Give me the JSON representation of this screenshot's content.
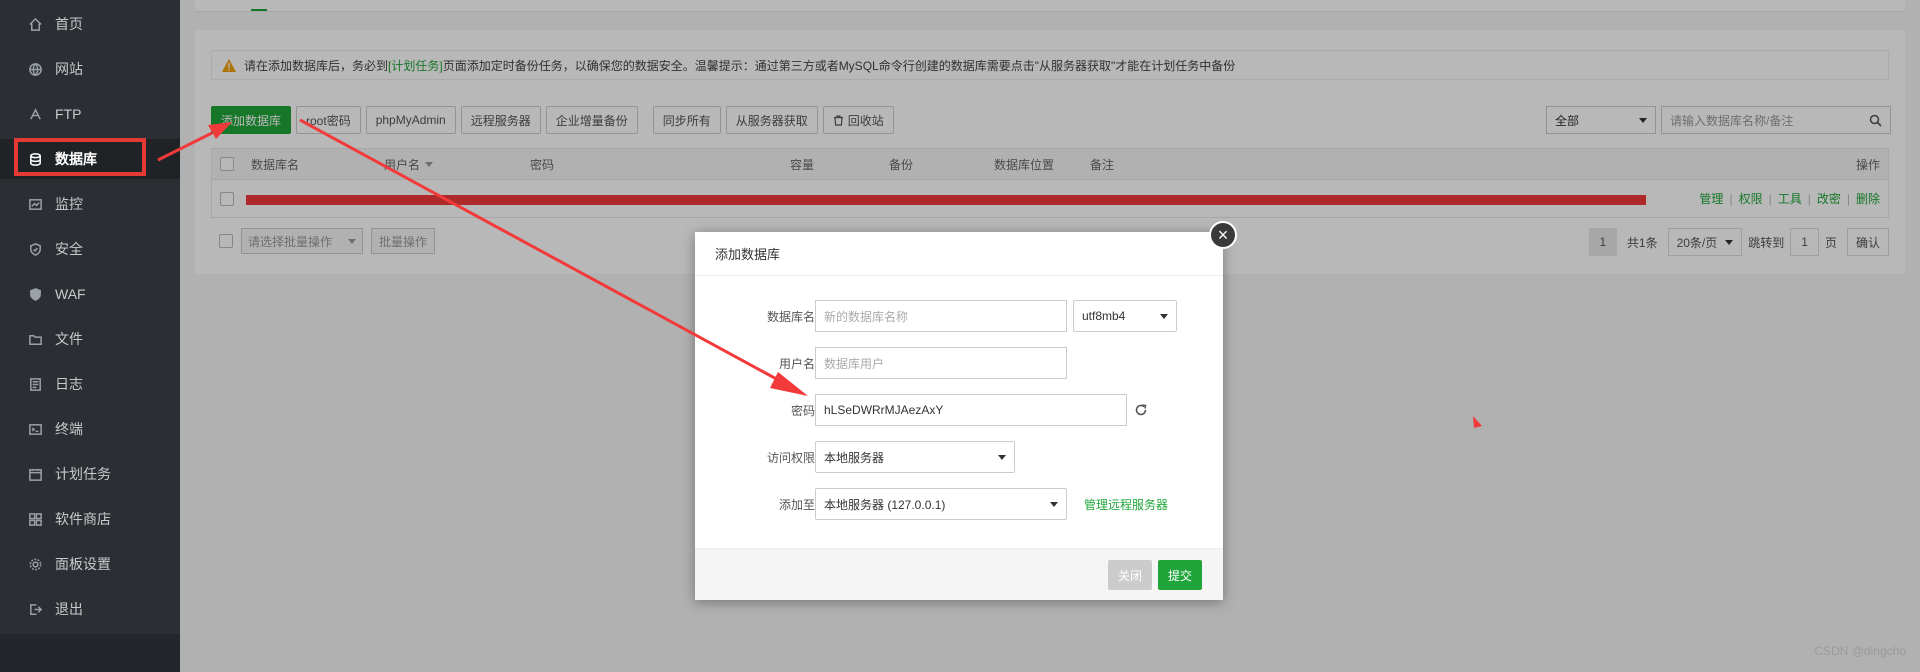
{
  "sidebar": {
    "items": [
      {
        "label": "首页",
        "icon": "home-icon"
      },
      {
        "label": "网站",
        "icon": "globe-icon"
      },
      {
        "label": "FTP",
        "icon": "ftp-icon"
      },
      {
        "label": "数据库",
        "icon": "database-icon",
        "active": true
      },
      {
        "label": "监控",
        "icon": "monitor-icon"
      },
      {
        "label": "安全",
        "icon": "shield-icon"
      },
      {
        "label": "WAF",
        "icon": "waf-shield-icon"
      },
      {
        "label": "文件",
        "icon": "folder-icon"
      },
      {
        "label": "日志",
        "icon": "log-icon"
      },
      {
        "label": "终端",
        "icon": "terminal-icon"
      },
      {
        "label": "计划任务",
        "icon": "calendar-icon"
      },
      {
        "label": "软件商店",
        "icon": "grid-icon"
      },
      {
        "label": "面板设置",
        "icon": "gear-icon"
      },
      {
        "label": "退出",
        "icon": "logout-icon"
      }
    ]
  },
  "alert": {
    "prefix": "请在添加数据库后，务必到",
    "link": "[计划任务]",
    "suffix": "页面添加定时备份任务，以确保您的数据安全。温馨提示：通过第三方或者MySQL命令行创建的数据库需要点击\"从服务器获取\"才能在计划任务中备份"
  },
  "toolbar": {
    "add_db": "添加数据库",
    "root_pw": "root密码",
    "phpmyadmin": "phpMyAdmin",
    "remote": "远程服务器",
    "incremental": "企业增量备份",
    "sync_all": "同步所有",
    "fetch": "从服务器获取",
    "recycle": "回收站"
  },
  "filter": {
    "select_value": "全部",
    "search_placeholder": "请输入数据库名称/备注"
  },
  "table": {
    "headers": {
      "name": "数据库名",
      "user": "用户名",
      "password": "密码",
      "size": "容量",
      "backup": "备份",
      "location": "数据库位置",
      "note": "备注",
      "ops": "操作"
    },
    "row_ops": [
      "管理",
      "权限",
      "工具",
      "改密",
      "删除"
    ]
  },
  "footer": {
    "batch_placeholder": "请选择批量操作",
    "batch_btn": "批量操作",
    "page": "1",
    "total": "共1条",
    "per_page": "20条/页",
    "jump_label": "跳转到",
    "jump_value": "1",
    "page_unit": "页",
    "confirm": "确认"
  },
  "modal": {
    "title": "添加数据库",
    "fields": {
      "db_name_label": "数据库名",
      "db_name_placeholder": "新的数据库名称",
      "charset": "utf8mb4",
      "user_label": "用户名",
      "user_placeholder": "数据库用户",
      "password_label": "密码",
      "password_value": "hLSeDWRrMJAezAxY",
      "access_label": "访问权限",
      "access_value": "本地服务器",
      "add_to_label": "添加至",
      "add_to_value": "本地服务器 (127.0.0.1)",
      "manage_remote": "管理远程服务器"
    },
    "close_btn": "关闭",
    "submit_btn": "提交"
  },
  "watermark": "CSDN @dingcho",
  "colors": {
    "accent": "#20a53a",
    "annotation": "#f23a3a",
    "sidebar": "#2b2f33"
  }
}
